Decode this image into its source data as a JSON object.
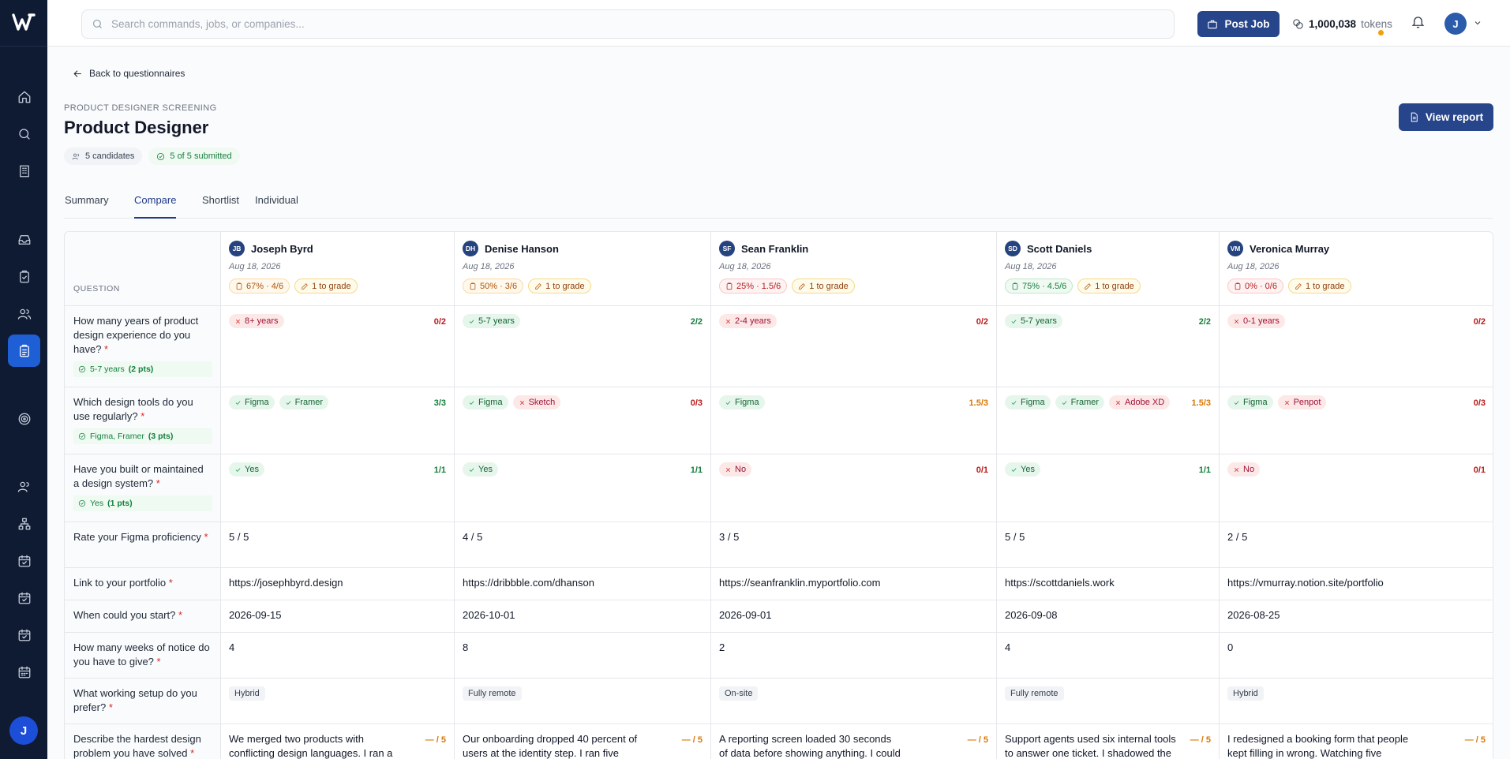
{
  "app": {
    "initial": "J"
  },
  "search": {
    "placeholder": "Search commands, jobs, or companies..."
  },
  "topbar": {
    "post_job": "Post Job",
    "tokens_value": "1,000,038",
    "tokens_label": "tokens",
    "avatar": "J"
  },
  "page": {
    "back": "Back to questionnaires",
    "eyebrow": "PRODUCT DESIGNER SCREENING",
    "title": "Product Designer",
    "candidates_chip": "5 candidates",
    "submitted_chip": "5 of 5 submitted",
    "view_report": "View report"
  },
  "tabs": [
    "Summary",
    "Compare",
    "Shortlist",
    "Individual"
  ],
  "table": {
    "question_header": "QUESTION",
    "candidates": [
      {
        "initials": "JB",
        "name": "Joseph Byrd",
        "date": "Aug 18, 2026",
        "score": "67% · 4/6",
        "score_tone": "amber",
        "grade": "1 to grade"
      },
      {
        "initials": "DH",
        "name": "Denise Hanson",
        "date": "Aug 18, 2026",
        "score": "50% · 3/6",
        "score_tone": "amber",
        "grade": "1 to grade"
      },
      {
        "initials": "SF",
        "name": "Sean Franklin",
        "date": "Aug 18, 2026",
        "score": "25% · 1.5/6",
        "score_tone": "red",
        "grade": "1 to grade"
      },
      {
        "initials": "SD",
        "name": "Scott Daniels",
        "date": "Aug 18, 2026",
        "score": "75% · 4.5/6",
        "score_tone": "green",
        "grade": "1 to grade"
      },
      {
        "initials": "VM",
        "name": "Veronica Murray",
        "date": "Aug 18, 2026",
        "score": "0% · 0/6",
        "score_tone": "red",
        "grade": "1 to grade"
      }
    ],
    "rows": [
      {
        "question": "How many years of product design experience do you have?",
        "expected": "5-7 years",
        "expected_pts": "(2 pts)",
        "answers": [
          {
            "tags": [
              {
                "t": "8+ years",
                "ok": false
              }
            ],
            "pts": "0/2",
            "tone": "r"
          },
          {
            "tags": [
              {
                "t": "5-7 years",
                "ok": true
              }
            ],
            "pts": "2/2",
            "tone": "g"
          },
          {
            "tags": [
              {
                "t": "2-4 years",
                "ok": false
              }
            ],
            "pts": "0/2",
            "tone": "r"
          },
          {
            "tags": [
              {
                "t": "5-7 years",
                "ok": true
              }
            ],
            "pts": "2/2",
            "tone": "g"
          },
          {
            "tags": [
              {
                "t": "0-1 years",
                "ok": false
              }
            ],
            "pts": "0/2",
            "tone": "r"
          }
        ]
      },
      {
        "question": "Which design tools do you use regularly?",
        "expected": "Figma, Framer",
        "expected_pts": "(3 pts)",
        "answers": [
          {
            "tags": [
              {
                "t": "Figma",
                "ok": true
              },
              {
                "t": "Framer",
                "ok": true
              }
            ],
            "pts": "3/3",
            "tone": "g"
          },
          {
            "tags": [
              {
                "t": "Figma",
                "ok": true
              },
              {
                "t": "Sketch",
                "ok": false
              }
            ],
            "pts": "0/3",
            "tone": "r"
          },
          {
            "tags": [
              {
                "t": "Figma",
                "ok": true
              }
            ],
            "pts": "1.5/3",
            "tone": "a"
          },
          {
            "tags": [
              {
                "t": "Figma",
                "ok": true
              },
              {
                "t": "Framer",
                "ok": true
              },
              {
                "t": "Adobe XD",
                "ok": false
              }
            ],
            "pts": "1.5/3",
            "tone": "a"
          },
          {
            "tags": [
              {
                "t": "Figma",
                "ok": true
              },
              {
                "t": "Penpot",
                "ok": false
              }
            ],
            "pts": "0/3",
            "tone": "r"
          }
        ]
      },
      {
        "question": "Have you built or maintained a design system?",
        "expected": "Yes",
        "expected_pts": "(1 pts)",
        "answers": [
          {
            "tags": [
              {
                "t": "Yes",
                "ok": true
              }
            ],
            "pts": "1/1",
            "tone": "g"
          },
          {
            "tags": [
              {
                "t": "Yes",
                "ok": true
              }
            ],
            "pts": "1/1",
            "tone": "g"
          },
          {
            "tags": [
              {
                "t": "No",
                "ok": false
              }
            ],
            "pts": "0/1",
            "tone": "r"
          },
          {
            "tags": [
              {
                "t": "Yes",
                "ok": true
              }
            ],
            "pts": "1/1",
            "tone": "g"
          },
          {
            "tags": [
              {
                "t": "No",
                "ok": false
              }
            ],
            "pts": "0/1",
            "tone": "r"
          }
        ]
      }
    ],
    "plain_rows": [
      {
        "question": "Rate your Figma proficiency",
        "answers": [
          "5 / 5",
          "4 / 5",
          "3 / 5",
          "5 / 5",
          "2 / 5"
        ]
      },
      {
        "question": "Link to your portfolio",
        "answers": [
          "https://josephbyrd.design",
          "https://dribbble.com/dhanson",
          "https://seanfranklin.myportfolio.com",
          "https://scottdaniels.work",
          "https://vmurray.notion.site/portfolio"
        ]
      },
      {
        "question": "When could you start?",
        "answers": [
          "2026-09-15",
          "2026-10-01",
          "2026-09-01",
          "2026-09-08",
          "2026-08-25"
        ]
      },
      {
        "question": "How many weeks of notice do you have to give?",
        "answers": [
          "4",
          "8",
          "2",
          "4",
          "0"
        ]
      }
    ],
    "setup_row": {
      "question": "What working setup do you prefer?",
      "answers": [
        "Hybrid",
        "Fully remote",
        "On-site",
        "Fully remote",
        "Hybrid"
      ]
    },
    "long_row": {
      "question": "Describe the hardest design problem you have solved",
      "pts": "— / 5",
      "answers": [
        "We merged two products with conflicting design languages. I ran a",
        "Our onboarding dropped 40 percent of users at the identity step. I ran five moderated",
        "A reporting screen loaded 30 seconds of data before showing anything. I could not fix the query,",
        "Support agents used six internal tools to answer one ticket. I shadowed the",
        "I redesigned a booking form that people kept filling in wrong. Watching five users showed the"
      ]
    }
  }
}
